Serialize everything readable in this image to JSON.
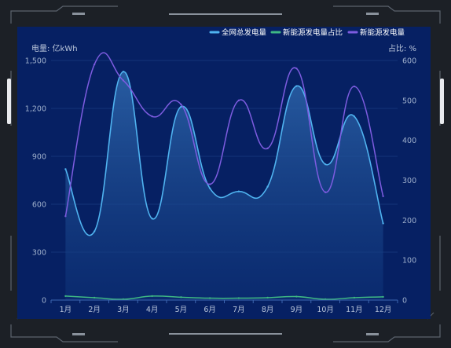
{
  "chart_data": {
    "type": "line",
    "title": "",
    "categories": [
      "1月",
      "2月",
      "3月",
      "4月",
      "5月",
      "6月",
      "7月",
      "8月",
      "9月",
      "10月",
      "11月",
      "12月"
    ],
    "y_left": {
      "label": "电量: 亿kWh",
      "ticks": [
        "0",
        "300",
        "600",
        "900",
        "1,200",
        "1,500"
      ],
      "ylim": [
        0,
        1500
      ]
    },
    "y_right": {
      "label": "占比: %",
      "ticks": [
        "0",
        "100",
        "200",
        "300",
        "400",
        "500",
        "600"
      ],
      "ylim": [
        0,
        600
      ]
    },
    "series": [
      {
        "name": "全网总发电量",
        "axis": "left",
        "color": "#4fb3f0",
        "area": true,
        "values": [
          820,
          430,
          1430,
          510,
          1210,
          700,
          680,
          710,
          1340,
          850,
          1150,
          480
        ]
      },
      {
        "name": "新能源发电量占比",
        "axis": "left",
        "color": "#3fb984",
        "area": false,
        "values": [
          25,
          15,
          5,
          25,
          18,
          12,
          12,
          15,
          22,
          5,
          15,
          20
        ]
      },
      {
        "name": "新能源发电量",
        "axis": "right",
        "color": "#7d5ce0",
        "area": false,
        "values": [
          210,
          590,
          550,
          460,
          490,
          290,
          500,
          380,
          580,
          270,
          535,
          260
        ]
      }
    ],
    "legend_position": "top-right",
    "grid": true
  }
}
